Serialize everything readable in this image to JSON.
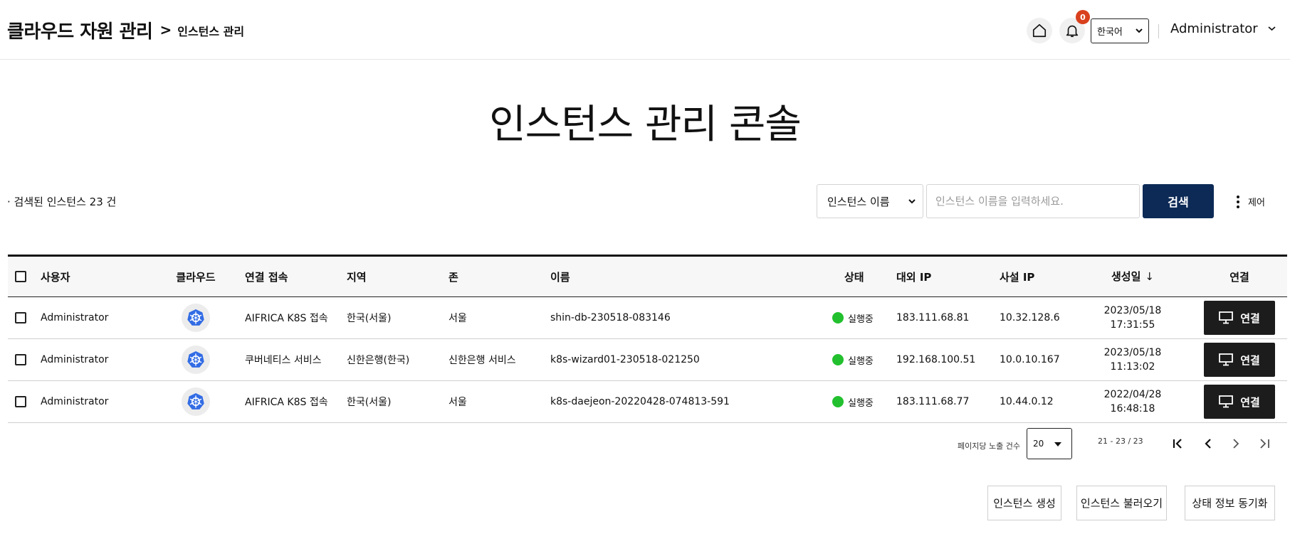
{
  "breadcrumb": {
    "root": "클라우드 자원 관리",
    "separator": ">",
    "current": "인스턴스 관리"
  },
  "header": {
    "notification_count": "0",
    "language": "한국어",
    "user": "Administrator"
  },
  "page": {
    "title": "인스턴스 관리 콘솔"
  },
  "toolbar": {
    "result_count": "· 검색된 인스턴스 23 건",
    "search_type": "인스턴스 이름",
    "search_placeholder": "인스턴스 이름을 입력하세요.",
    "search_label": "검색",
    "control_label": "제어"
  },
  "table": {
    "columns": {
      "user": "사용자",
      "cloud": "클라우드",
      "connection": "연결 접속",
      "region": "지역",
      "zone": "존",
      "name": "이름",
      "status": "상태",
      "public_ip": "대외 IP",
      "private_ip": "사설 IP",
      "created": "생성일",
      "connect": "연결"
    },
    "sort_indicator": "↓",
    "cloud_icon": "kubernetes-icon",
    "connect_icon": "monitor-icon",
    "rows": [
      {
        "user": "Administrator",
        "connection": "AIFRICA K8S 접속",
        "region": "한국(서울)",
        "zone": "서울",
        "name": "shin-db-230518-083146",
        "status": "실행중",
        "public_ip": "183.111.68.81",
        "private_ip": "10.32.128.6",
        "created_date": "2023/05/18",
        "created_time": "17:31:55",
        "connect_label": "연결"
      },
      {
        "user": "Administrator",
        "connection": "쿠버네티스 서비스",
        "region": "신한은행(한국)",
        "zone": "신한은행 서비스",
        "name": "k8s-wizard01-230518-021250",
        "status": "실행중",
        "public_ip": "192.168.100.51",
        "private_ip": "10.0.10.167",
        "created_date": "2023/05/18",
        "created_time": "11:13:02",
        "connect_label": "연결"
      },
      {
        "user": "Administrator",
        "connection": "AIFRICA K8S 접속",
        "region": "한국(서울)",
        "zone": "서울",
        "name": "k8s-daejeon-20220428-074813-591",
        "status": "실행중",
        "public_ip": "183.111.68.77",
        "private_ip": "10.44.0.12",
        "created_date": "2022/04/28",
        "created_time": "16:48:18",
        "connect_label": "연결"
      }
    ]
  },
  "pagination": {
    "per_page_label": "페이지당 노출 건수",
    "per_page_value": "20",
    "range": "21 - 23 / 23"
  },
  "actions": {
    "create": "인스턴스 생성",
    "import": "인스턴스 불러오기",
    "sync": "상태 정보 동기화"
  },
  "colors": {
    "search_button": "#0d2a56",
    "connect_button": "#1c1c1c",
    "badge": "#d9411e",
    "status_running": "#22c02e",
    "kubernetes": "#326ce5"
  }
}
